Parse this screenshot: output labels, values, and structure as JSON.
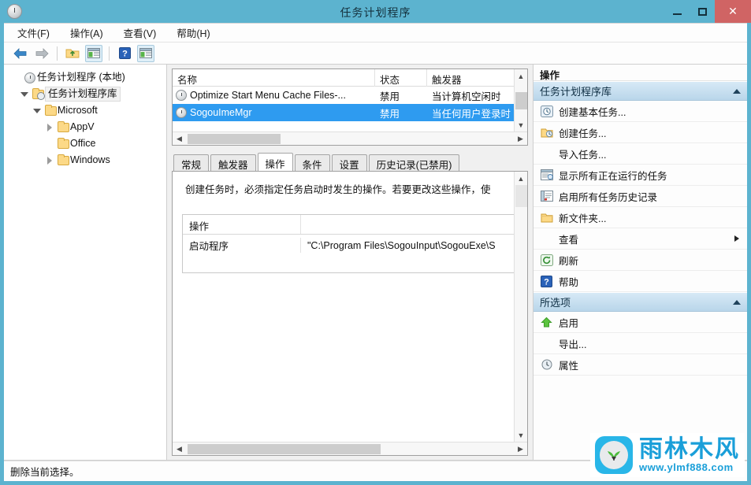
{
  "window": {
    "title": "任务计划程序",
    "icon": "clock-icon",
    "minimize_label": "最小化",
    "maximize_label": "最大化",
    "close_label": "✕",
    "titlebar_color": "#5cb3cf",
    "close_button_color": "#d06464"
  },
  "menubar": {
    "items": [
      {
        "label": "文件(F)",
        "name": "menu-file"
      },
      {
        "label": "操作(A)",
        "name": "menu-action"
      },
      {
        "label": "查看(V)",
        "name": "menu-view"
      },
      {
        "label": "帮助(H)",
        "name": "menu-help"
      }
    ]
  },
  "toolbar": {
    "items": [
      {
        "name": "back-arrow-icon",
        "label": "后退"
      },
      {
        "name": "forward-arrow-icon",
        "label": "前进"
      },
      {
        "name": "up-folder-icon",
        "label": "向上一级"
      },
      {
        "name": "show-hide-console-tree-icon",
        "label": "显示/隐藏控制台树"
      },
      {
        "name": "help-icon",
        "label": "帮助"
      },
      {
        "name": "show-hide-action-pane-icon",
        "label": "显示/隐藏操作窗格"
      }
    ]
  },
  "tree": {
    "items": [
      {
        "label": "任务计划程序 (本地)",
        "indent": 0,
        "icon": "clock-icon",
        "twisty": "none",
        "selected": false
      },
      {
        "label": "任务计划程序库",
        "indent": 1,
        "icon": "folder-clock-icon",
        "twisty": "expanded",
        "selected": true
      },
      {
        "label": "Microsoft",
        "indent": 2,
        "icon": "folder-icon",
        "twisty": "expanded",
        "selected": false
      },
      {
        "label": "AppV",
        "indent": 3,
        "icon": "folder-icon",
        "twisty": "collapsed",
        "selected": false
      },
      {
        "label": "Office",
        "indent": 3,
        "icon": "folder-icon",
        "twisty": "none",
        "selected": false
      },
      {
        "label": "Windows",
        "indent": 3,
        "icon": "folder-icon",
        "twisty": "collapsed",
        "selected": false
      }
    ]
  },
  "tasklist": {
    "columns": [
      "名称",
      "状态",
      "触发器"
    ],
    "rows": [
      {
        "name": "Optimize Start Menu Cache Files-...",
        "state": "禁用",
        "trigger": "当计算机空闲时",
        "selected": false
      },
      {
        "name": "SogouImeMgr",
        "state": "禁用",
        "trigger": "当任何用户登录时",
        "selected": true
      }
    ],
    "selection_color": "#2e9bf0"
  },
  "tabs": {
    "items": [
      {
        "label": "常规",
        "active": false
      },
      {
        "label": "触发器",
        "active": false
      },
      {
        "label": "操作",
        "active": true
      },
      {
        "label": "条件",
        "active": false
      },
      {
        "label": "设置",
        "active": false
      },
      {
        "label": "历史记录(已禁用)",
        "active": false
      }
    ]
  },
  "tabpanel": {
    "description": "创建任务时，必须指定任务启动时发生的操作。若要更改这些操作，使",
    "table": {
      "columns": [
        "操作",
        ""
      ],
      "rows": [
        {
          "action": "启动程序",
          "details": "\"C:\\Program Files\\SogouInput\\SogouExe\\S"
        }
      ]
    }
  },
  "actions_pane": {
    "title": "操作",
    "groups": [
      {
        "header": "任务计划程序库",
        "collapse_icon": "chevron-up-icon",
        "items": [
          {
            "label": "创建基本任务...",
            "icon": "create-basic-task-icon",
            "submenu": false
          },
          {
            "label": "创建任务...",
            "icon": "create-task-icon",
            "submenu": false
          },
          {
            "label": "导入任务...",
            "icon": "none",
            "submenu": false
          },
          {
            "label": "显示所有正在运行的任务",
            "icon": "running-tasks-icon",
            "submenu": false
          },
          {
            "label": "启用所有任务历史记录",
            "icon": "task-history-icon",
            "submenu": false
          },
          {
            "label": "新文件夹...",
            "icon": "new-folder-icon",
            "submenu": false
          },
          {
            "label": "查看",
            "icon": "none",
            "submenu": true
          },
          {
            "label": "刷新",
            "icon": "refresh-icon",
            "submenu": false
          },
          {
            "label": "帮助",
            "icon": "help-icon",
            "submenu": false
          }
        ]
      },
      {
        "header": "所选项",
        "collapse_icon": "chevron-up-icon",
        "items": [
          {
            "label": "启用",
            "icon": "green-up-arrow-icon",
            "submenu": false
          },
          {
            "label": "导出...",
            "icon": "none",
            "submenu": false
          },
          {
            "label": "属性",
            "icon": "clock-icon",
            "submenu": false
          }
        ]
      }
    ]
  },
  "statusbar": {
    "text": "删除当前选择。"
  },
  "watermark": {
    "brand": "雨林木风",
    "url": "www.ylmf888.com",
    "color": "#1a9fd9"
  }
}
